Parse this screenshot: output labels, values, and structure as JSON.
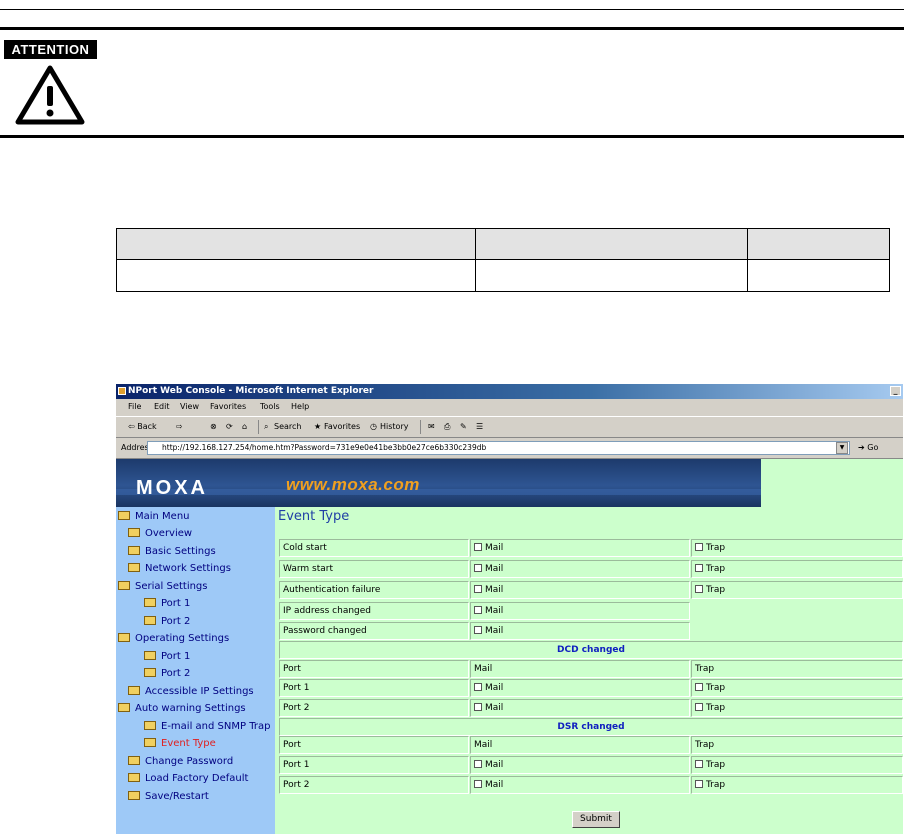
{
  "attention": {
    "label": "ATTENTION"
  },
  "browser": {
    "title": "NPort Web Console - Microsoft Internet Explorer",
    "menu": [
      "File",
      "Edit",
      "View",
      "Favorites",
      "Tools",
      "Help"
    ],
    "toolbar": {
      "back": "⇦ Back",
      "forward": "⇨",
      "search": "Search",
      "favorites": "Favorites",
      "history": "History"
    },
    "address_label": "Address",
    "address_value": "http://192.168.127.254/home.htm?Password=731e9e0e41be3bb0e27ce6b330c239db",
    "go_label": "Go"
  },
  "banner": {
    "logo": "MOXA",
    "url": "www.moxa.com"
  },
  "nav": {
    "main_menu": "Main Menu",
    "overview": "Overview",
    "basic_settings": "Basic Settings",
    "network_settings": "Network Settings",
    "serial_settings": "Serial Settings",
    "serial_port1": "Port 1",
    "serial_port2": "Port 2",
    "operating_settings": "Operating Settings",
    "operating_port1": "Port 1",
    "operating_port2": "Port 2",
    "accessible_ip": "Accessible IP Settings",
    "auto_warning": "Auto warning Settings",
    "email_snmp": "E-mail and SNMP Trap",
    "event_type": "Event Type",
    "change_password": "Change Password",
    "load_factory": "Load Factory Default",
    "save_restart": "Save/Restart"
  },
  "content": {
    "title": "Event Type",
    "mail": "Mail",
    "trap": "Trap",
    "events": {
      "cold_start": "Cold start",
      "warm_start": "Warm start",
      "auth_failure": "Authentication failure",
      "ip_changed": "IP address changed",
      "password_changed": "Password changed"
    },
    "dcd": {
      "heading": "DCD changed",
      "col_port": "Port",
      "col_mail": "Mail",
      "col_trap": "Trap",
      "port1": "Port 1",
      "port2": "Port 2"
    },
    "dsr": {
      "heading": "DSR changed",
      "col_port": "Port",
      "col_mail": "Mail",
      "col_trap": "Trap",
      "port1": "Port 1",
      "port2": "Port 2"
    },
    "submit": "Submit"
  }
}
